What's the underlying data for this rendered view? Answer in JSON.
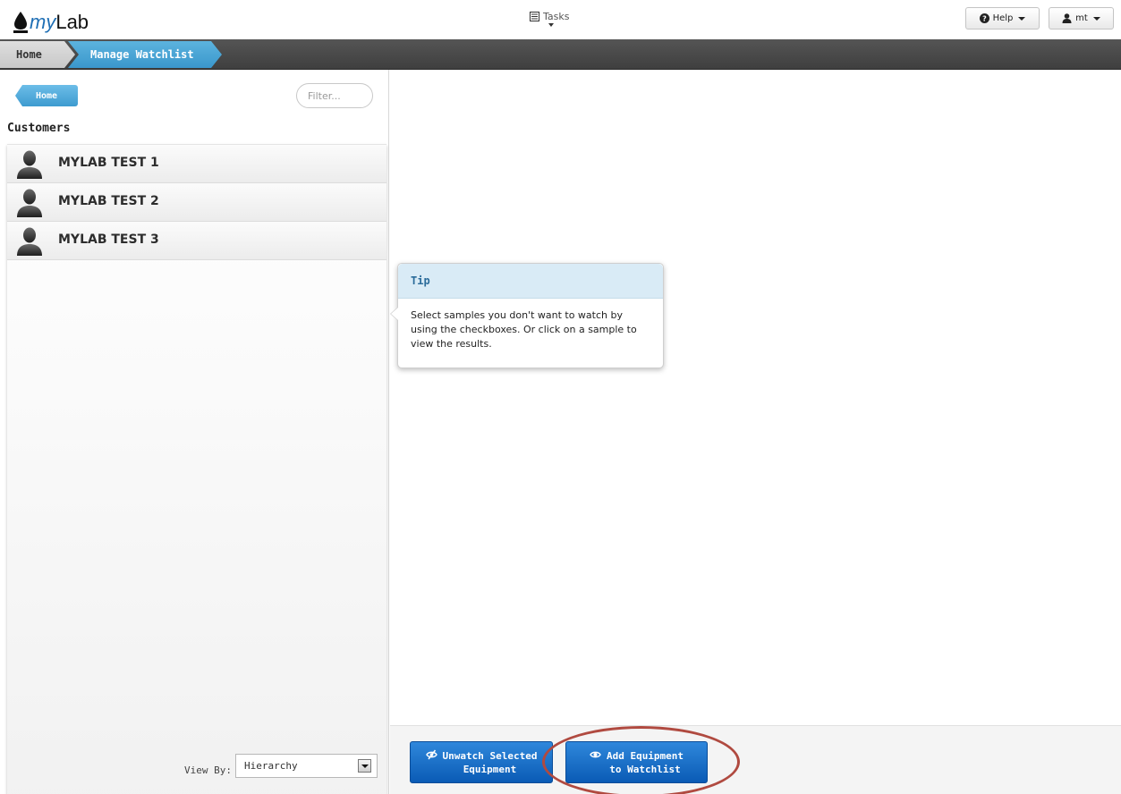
{
  "app": {
    "logo_my": "my",
    "logo_lab": "Lab",
    "tasks_label": "Tasks",
    "help_label": "Help",
    "user_label": "mt"
  },
  "breadcrumb": {
    "home": "Home",
    "current": "Manage Watchlist"
  },
  "sidebar": {
    "home_button": "Home",
    "filter_placeholder": "Filter...",
    "section_title": "Customers",
    "customers": [
      {
        "name": "MYLAB TEST 1"
      },
      {
        "name": "MYLAB TEST 2"
      },
      {
        "name": "MYLAB TEST 3"
      }
    ],
    "view_by_label": "View By:",
    "view_by_value": "Hierarchy"
  },
  "tip": {
    "title": "Tip",
    "text": "Select samples you don't want to watch by using the checkboxes. Or click on a sample to view the results."
  },
  "actions": {
    "unwatch_line1": "Unwatch Selected",
    "unwatch_line2": "Equipment",
    "add_line1": "Add Equipment",
    "add_line2": "to Watchlist"
  },
  "colors": {
    "accent_blue": "#3a97cc",
    "button_blue": "#0a5bb5",
    "highlight_ring": "#b04a40",
    "crumb_bar": "#4a4a4a"
  },
  "icons": {
    "tasks": "list-icon",
    "help": "question-circle-icon",
    "user": "user-icon",
    "customer": "person-silhouette-icon",
    "unwatch": "eye-slash-icon",
    "add": "eye-icon"
  }
}
